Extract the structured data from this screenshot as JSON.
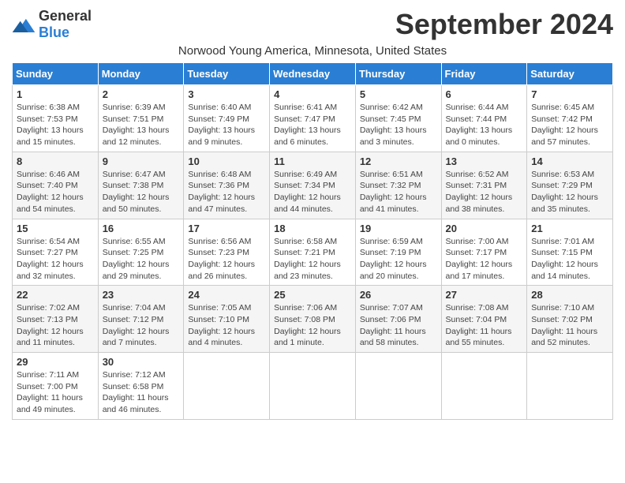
{
  "header": {
    "logo_general": "General",
    "logo_blue": "Blue",
    "month_title": "September 2024",
    "subtitle": "Norwood Young America, Minnesota, United States"
  },
  "days_of_week": [
    "Sunday",
    "Monday",
    "Tuesday",
    "Wednesday",
    "Thursday",
    "Friday",
    "Saturday"
  ],
  "weeks": [
    [
      {
        "day": "1",
        "info": "Sunrise: 6:38 AM\nSunset: 7:53 PM\nDaylight: 13 hours\nand 15 minutes."
      },
      {
        "day": "2",
        "info": "Sunrise: 6:39 AM\nSunset: 7:51 PM\nDaylight: 13 hours\nand 12 minutes."
      },
      {
        "day": "3",
        "info": "Sunrise: 6:40 AM\nSunset: 7:49 PM\nDaylight: 13 hours\nand 9 minutes."
      },
      {
        "day": "4",
        "info": "Sunrise: 6:41 AM\nSunset: 7:47 PM\nDaylight: 13 hours\nand 6 minutes."
      },
      {
        "day": "5",
        "info": "Sunrise: 6:42 AM\nSunset: 7:45 PM\nDaylight: 13 hours\nand 3 minutes."
      },
      {
        "day": "6",
        "info": "Sunrise: 6:44 AM\nSunset: 7:44 PM\nDaylight: 13 hours\nand 0 minutes."
      },
      {
        "day": "7",
        "info": "Sunrise: 6:45 AM\nSunset: 7:42 PM\nDaylight: 12 hours\nand 57 minutes."
      }
    ],
    [
      {
        "day": "8",
        "info": "Sunrise: 6:46 AM\nSunset: 7:40 PM\nDaylight: 12 hours\nand 54 minutes."
      },
      {
        "day": "9",
        "info": "Sunrise: 6:47 AM\nSunset: 7:38 PM\nDaylight: 12 hours\nand 50 minutes."
      },
      {
        "day": "10",
        "info": "Sunrise: 6:48 AM\nSunset: 7:36 PM\nDaylight: 12 hours\nand 47 minutes."
      },
      {
        "day": "11",
        "info": "Sunrise: 6:49 AM\nSunset: 7:34 PM\nDaylight: 12 hours\nand 44 minutes."
      },
      {
        "day": "12",
        "info": "Sunrise: 6:51 AM\nSunset: 7:32 PM\nDaylight: 12 hours\nand 41 minutes."
      },
      {
        "day": "13",
        "info": "Sunrise: 6:52 AM\nSunset: 7:31 PM\nDaylight: 12 hours\nand 38 minutes."
      },
      {
        "day": "14",
        "info": "Sunrise: 6:53 AM\nSunset: 7:29 PM\nDaylight: 12 hours\nand 35 minutes."
      }
    ],
    [
      {
        "day": "15",
        "info": "Sunrise: 6:54 AM\nSunset: 7:27 PM\nDaylight: 12 hours\nand 32 minutes."
      },
      {
        "day": "16",
        "info": "Sunrise: 6:55 AM\nSunset: 7:25 PM\nDaylight: 12 hours\nand 29 minutes."
      },
      {
        "day": "17",
        "info": "Sunrise: 6:56 AM\nSunset: 7:23 PM\nDaylight: 12 hours\nand 26 minutes."
      },
      {
        "day": "18",
        "info": "Sunrise: 6:58 AM\nSunset: 7:21 PM\nDaylight: 12 hours\nand 23 minutes."
      },
      {
        "day": "19",
        "info": "Sunrise: 6:59 AM\nSunset: 7:19 PM\nDaylight: 12 hours\nand 20 minutes."
      },
      {
        "day": "20",
        "info": "Sunrise: 7:00 AM\nSunset: 7:17 PM\nDaylight: 12 hours\nand 17 minutes."
      },
      {
        "day": "21",
        "info": "Sunrise: 7:01 AM\nSunset: 7:15 PM\nDaylight: 12 hours\nand 14 minutes."
      }
    ],
    [
      {
        "day": "22",
        "info": "Sunrise: 7:02 AM\nSunset: 7:13 PM\nDaylight: 12 hours\nand 11 minutes."
      },
      {
        "day": "23",
        "info": "Sunrise: 7:04 AM\nSunset: 7:12 PM\nDaylight: 12 hours\nand 7 minutes."
      },
      {
        "day": "24",
        "info": "Sunrise: 7:05 AM\nSunset: 7:10 PM\nDaylight: 12 hours\nand 4 minutes."
      },
      {
        "day": "25",
        "info": "Sunrise: 7:06 AM\nSunset: 7:08 PM\nDaylight: 12 hours\nand 1 minute."
      },
      {
        "day": "26",
        "info": "Sunrise: 7:07 AM\nSunset: 7:06 PM\nDaylight: 11 hours\nand 58 minutes."
      },
      {
        "day": "27",
        "info": "Sunrise: 7:08 AM\nSunset: 7:04 PM\nDaylight: 11 hours\nand 55 minutes."
      },
      {
        "day": "28",
        "info": "Sunrise: 7:10 AM\nSunset: 7:02 PM\nDaylight: 11 hours\nand 52 minutes."
      }
    ],
    [
      {
        "day": "29",
        "info": "Sunrise: 7:11 AM\nSunset: 7:00 PM\nDaylight: 11 hours\nand 49 minutes."
      },
      {
        "day": "30",
        "info": "Sunrise: 7:12 AM\nSunset: 6:58 PM\nDaylight: 11 hours\nand 46 minutes."
      },
      {
        "day": "",
        "info": ""
      },
      {
        "day": "",
        "info": ""
      },
      {
        "day": "",
        "info": ""
      },
      {
        "day": "",
        "info": ""
      },
      {
        "day": "",
        "info": ""
      }
    ]
  ]
}
